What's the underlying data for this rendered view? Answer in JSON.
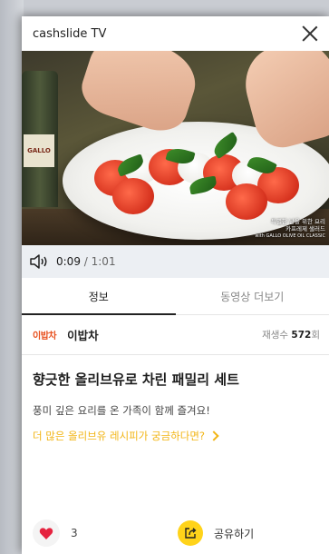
{
  "header": {
    "title": "cashslide TV"
  },
  "video": {
    "caption_line1": "특별한 날을 위한 요리",
    "caption_line2": "카프레제 샐러드",
    "caption_line3": "with GALLO OLIVE OIL CLASSIC",
    "bottle_text": "GALLO"
  },
  "player": {
    "current_time": "0:09",
    "separator": " / ",
    "duration": "1:01"
  },
  "tabs": [
    {
      "label": "정보"
    },
    {
      "label": "동영상 더보기"
    }
  ],
  "channel": {
    "logo_text": "이밥차",
    "name": "이밥차",
    "views_label": "재생수 ",
    "views_count": "572",
    "views_unit": "회"
  },
  "content": {
    "title": "향긋한 올리브유로 차린 패밀리 세트",
    "description": "풍미 깊은 요리를 온 가족이 함께 즐겨요!",
    "more_link": "더 많은 올리브유 레시피가 궁금하다면?"
  },
  "actions": {
    "like_count": "3",
    "share_label": "공유하기"
  },
  "colors": {
    "accent": "#ffd31a",
    "link": "#f2b515",
    "heart": "#e5233f"
  }
}
